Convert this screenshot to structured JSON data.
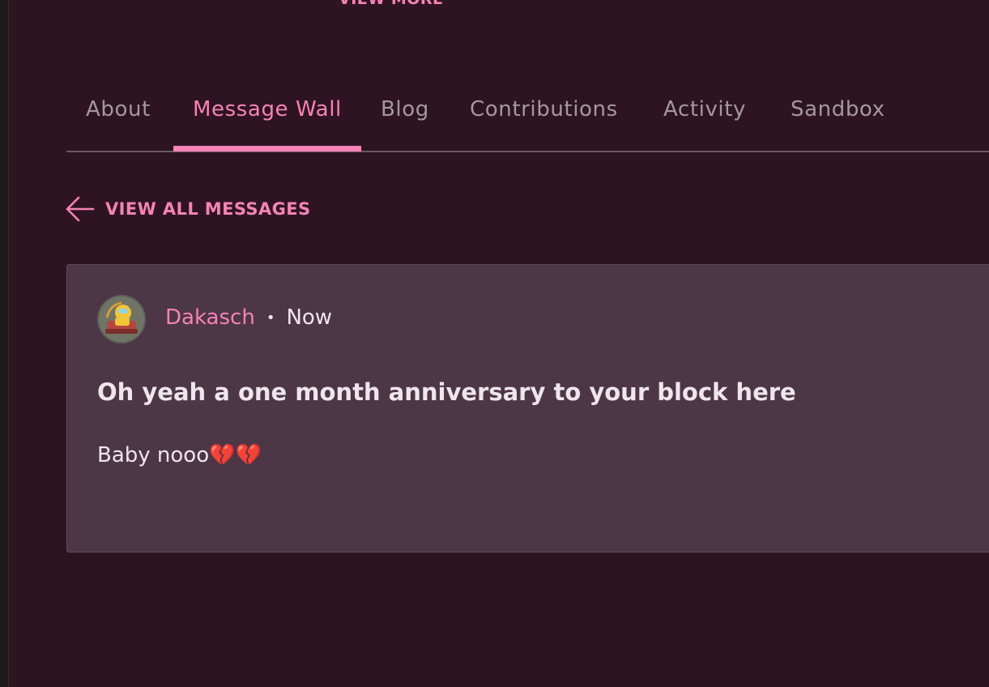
{
  "header": {
    "view_more_label": "VIEW MORE"
  },
  "tabs": [
    {
      "label": "About",
      "active": false
    },
    {
      "label": "Message Wall",
      "active": true
    },
    {
      "label": "Blog",
      "active": false
    },
    {
      "label": "Contributions",
      "active": false
    },
    {
      "label": "Activity",
      "active": false
    },
    {
      "label": "Sandbox",
      "active": false
    }
  ],
  "back_link": {
    "label": "VIEW ALL MESSAGES",
    "icon": "arrow-left-icon"
  },
  "message": {
    "avatar": "user-avatar",
    "author": "Dakasch",
    "separator": "•",
    "timestamp": "Now",
    "title": "Oh yeah a one month anniversary to your block here",
    "body": "Baby nooo💔💔"
  },
  "colors": {
    "accent": "#f583b6",
    "background": "#2e1421",
    "card": "#4d3645",
    "tab_inactive": "#a597a0",
    "text": "#efe6ec"
  }
}
